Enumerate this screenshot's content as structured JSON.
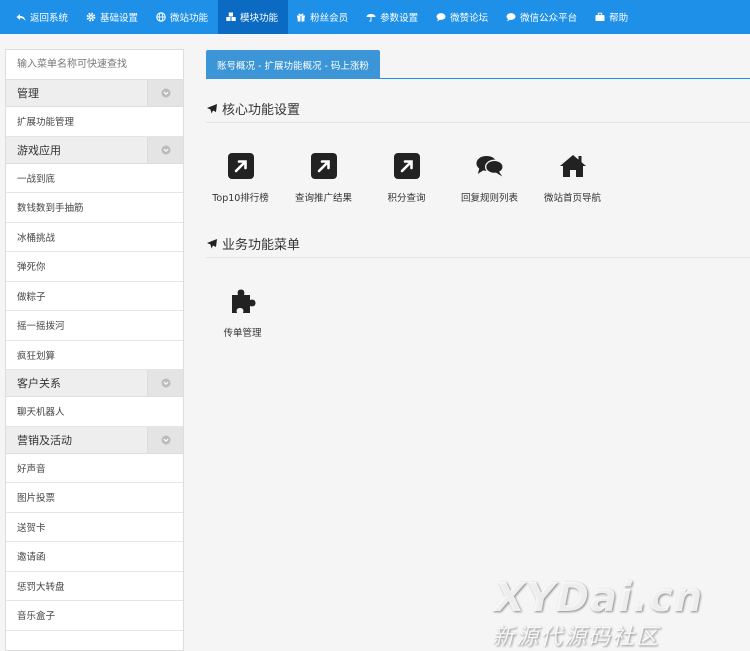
{
  "nav": {
    "items": [
      {
        "label": "返回系统",
        "icon": "reply-icon"
      },
      {
        "label": "基础设置",
        "icon": "gear-icon"
      },
      {
        "label": "微站功能",
        "icon": "globe-icon"
      },
      {
        "label": "模块功能",
        "icon": "cubes-icon"
      },
      {
        "label": "粉丝会员",
        "icon": "gift-icon"
      },
      {
        "label": "参数设置",
        "icon": "umbrella-icon"
      },
      {
        "label": "微赞论坛",
        "icon": "comment-icon"
      },
      {
        "label": "微信公众平台",
        "icon": "comment-icon"
      },
      {
        "label": "帮助",
        "icon": "briefcase-icon"
      }
    ],
    "active_index": 3,
    "color": "#1e90e8",
    "active_color": "#0b6bc2"
  },
  "sidebar": {
    "search_placeholder": "输入菜单名称可快速查找",
    "groups": [
      {
        "title": "管理",
        "items": [
          "扩展功能管理"
        ]
      },
      {
        "title": "游戏应用",
        "items": [
          "一战到底",
          "数钱数到手抽筋",
          "冰桶挑战",
          "弹死你",
          "做粽子",
          "摇一摇拨河",
          "疯狂划算"
        ]
      },
      {
        "title": "客户关系",
        "items": [
          "聊天机器人"
        ]
      },
      {
        "title": "营销及活动",
        "items": [
          "好声音",
          "图片投票",
          "送贺卡",
          "邀请函",
          "惩罚大转盘",
          "音乐盒子"
        ]
      }
    ]
  },
  "main": {
    "breadcrumb": "账号概况 - 扩展功能概况 - 码上涨粉",
    "sections": [
      {
        "title": "核心功能设置",
        "tiles": [
          {
            "label": "Top10排行榜",
            "icon": "external-link-icon"
          },
          {
            "label": "查询推广结果",
            "icon": "external-link-icon"
          },
          {
            "label": "积分查询",
            "icon": "external-link-icon"
          },
          {
            "label": "回复规则列表",
            "icon": "comments-icon"
          },
          {
            "label": "微站首页导航",
            "icon": "home-icon"
          }
        ]
      },
      {
        "title": "业务功能菜单",
        "tiles": [
          {
            "label": "传单管理",
            "icon": "puzzle-icon"
          }
        ]
      }
    ]
  },
  "watermark": {
    "big": "XYDai.cn",
    "small": "新源代源码社区"
  }
}
